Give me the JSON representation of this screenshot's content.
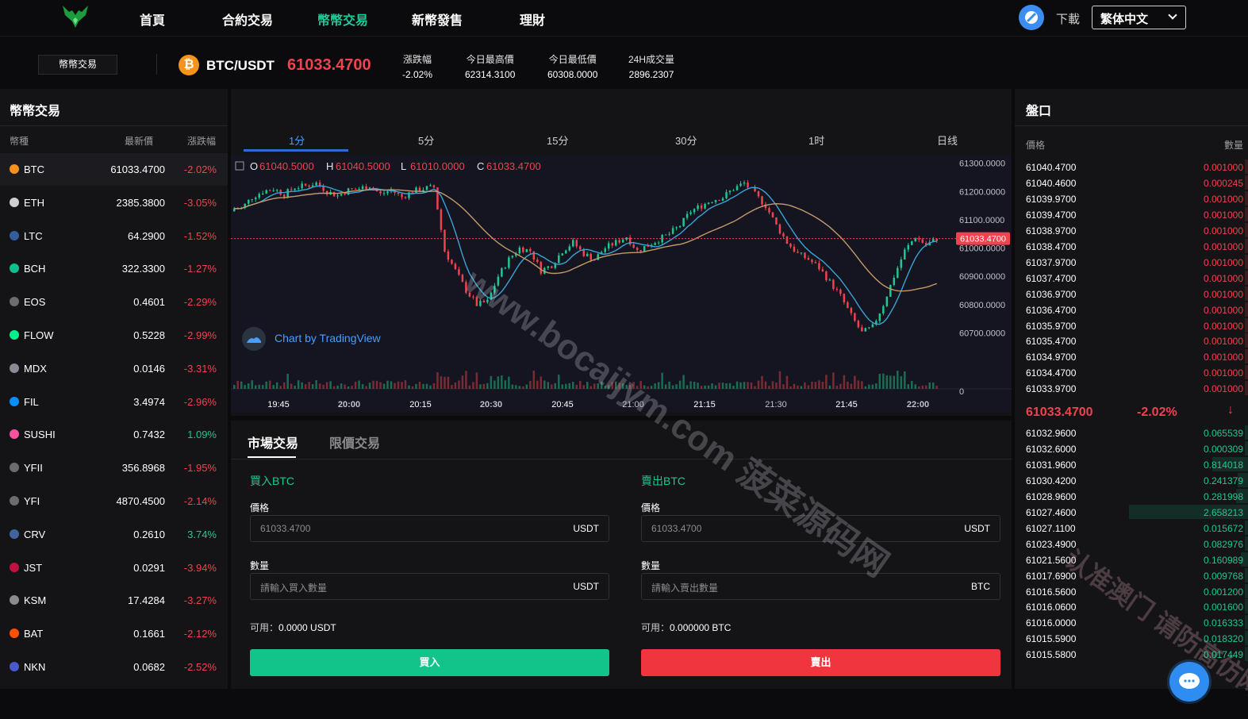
{
  "nav": {
    "items": [
      {
        "label": "首頁",
        "active": false
      },
      {
        "label": "合約交易",
        "active": false
      },
      {
        "label": "幣幣交易",
        "active": true
      },
      {
        "label": "新幣發售",
        "active": false
      },
      {
        "label": "理財",
        "active": false
      }
    ],
    "download_label": "下載",
    "language": "繁体中文"
  },
  "ticker": {
    "tab_label": "幣幣交易",
    "pair": "BTC/USDT",
    "last_price": "61033.4700",
    "stats": [
      {
        "label": "漲跌幅",
        "value": "-2.02%"
      },
      {
        "label": "今日最高價",
        "value": "62314.3100"
      },
      {
        "label": "今日最低價",
        "value": "60308.0000"
      },
      {
        "label": "24H成交量",
        "value": "2896.2307"
      }
    ]
  },
  "market": {
    "title": "幣幣交易",
    "headers": {
      "coin": "幣種",
      "price": "最新價",
      "change": "漲跌幅"
    },
    "rows": [
      {
        "coin": "BTC",
        "price": "61033.4700",
        "change": "-2.02%",
        "color": "#f7931a"
      },
      {
        "coin": "ETH",
        "price": "2385.3800",
        "change": "-3.05%",
        "color": "#cfcfcf"
      },
      {
        "coin": "LTC",
        "price": "64.2900",
        "change": "-1.52%",
        "color": "#345d9d"
      },
      {
        "coin": "BCH",
        "price": "322.3300",
        "change": "-1.27%",
        "color": "#0ac18e"
      },
      {
        "coin": "EOS",
        "price": "0.4601",
        "change": "-2.29%",
        "color": "#6b6b70"
      },
      {
        "coin": "FLOW",
        "price": "0.5228",
        "change": "-2.99%",
        "color": "#00ef8b"
      },
      {
        "coin": "MDX",
        "price": "0.0146",
        "change": "-3.31%",
        "color": "#8a8a95"
      },
      {
        "coin": "FIL",
        "price": "3.4974",
        "change": "-2.96%",
        "color": "#0090ff"
      },
      {
        "coin": "SUSHI",
        "price": "0.7432",
        "change": "1.09%",
        "color": "#fa52a0"
      },
      {
        "coin": "YFII",
        "price": "356.8968",
        "change": "-1.95%",
        "color": "#6b6b70"
      },
      {
        "coin": "YFI",
        "price": "4870.4500",
        "change": "-2.14%",
        "color": "#6b6b70"
      },
      {
        "coin": "CRV",
        "price": "0.2610",
        "change": "3.74%",
        "color": "#40649f"
      },
      {
        "coin": "JST",
        "price": "0.0291",
        "change": "-3.94%",
        "color": "#c2103f"
      },
      {
        "coin": "KSM",
        "price": "17.4284",
        "change": "-3.27%",
        "color": "#8a8a90"
      },
      {
        "coin": "BAT",
        "price": "0.1661",
        "change": "-2.12%",
        "color": "#ff5000"
      },
      {
        "coin": "NKN",
        "price": "0.0682",
        "change": "-2.52%",
        "color": "#4a5ac8"
      }
    ]
  },
  "chart": {
    "intervals": [
      "1分",
      "5分",
      "15分",
      "30分",
      "1时",
      "日线"
    ],
    "active_interval": "1分",
    "ohlc": {
      "o_label": "O",
      "o": "61040.5000",
      "h_label": "H",
      "h": "61040.5000",
      "l_label": "L",
      "l": "61010.0000",
      "c_label": "C",
      "c": "61033.4700"
    },
    "current_price_tag": "61033.4700",
    "attribution": "Chart by TradingView",
    "watermark": "www.bocaijym.com 菠菜源码网"
  },
  "chart_data": {
    "type": "candlestick",
    "y_ticks": [
      "61300.0000",
      "61200.0000",
      "61100.0000",
      "61000.0000",
      "60900.0000",
      "60800.0000",
      "60700.0000"
    ],
    "x_ticks": [
      "19:45",
      "20:00",
      "20:15",
      "20:30",
      "20:45",
      "21:00",
      "21:15",
      "21:30",
      "21:45",
      "22:00"
    ],
    "volume_zero_label": "0",
    "ylim": [
      60600,
      61330
    ],
    "close_path": [
      61140,
      61180,
      61200,
      61210,
      61190,
      61215,
      61220,
      61230,
      61200,
      61185,
      61205,
      61210,
      61220,
      61190,
      61205,
      61180,
      61200,
      61210,
      61215,
      60990,
      60920,
      60850,
      60800,
      60810,
      60900,
      60960,
      61000,
      60990,
      60920,
      60940,
      60990,
      61020,
      60980,
      60960,
      61000,
      61020,
      61040,
      60990,
      61010,
      61030,
      61050,
      61080,
      61130,
      61150,
      61170,
      61180,
      61210,
      61230,
      61190,
      61150,
      61080,
      61020,
      60980,
      60960,
      60930,
      60880,
      60830,
      60760,
      60700,
      60720,
      60800,
      60900,
      60990,
      61040,
      61010,
      61033
    ]
  },
  "trade": {
    "tabs": [
      "市場交易",
      "限價交易"
    ],
    "buy": {
      "title": "買入BTC",
      "price_label": "價格",
      "price_placeholder": "61033.4700",
      "price_unit": "USDT",
      "qty_label": "數量",
      "qty_placeholder": "請輸入買入數量",
      "qty_unit": "USDT",
      "avail_label": "可用：",
      "avail_value": "0.0000 USDT",
      "button": "買入"
    },
    "sell": {
      "title": "賣出BTC",
      "price_label": "價格",
      "price_placeholder": "61033.4700",
      "price_unit": "USDT",
      "qty_label": "數量",
      "qty_placeholder": "請輸入賣出數量",
      "qty_unit": "BTC",
      "avail_label": "可用：",
      "avail_value": "0.000000 BTC",
      "button": "賣出"
    }
  },
  "orderbook": {
    "title": "盤口",
    "headers": {
      "price": "價格",
      "qty": "數量"
    },
    "asks": [
      {
        "price": "61040.4700",
        "qty": "0.001000",
        "depth": 0.02
      },
      {
        "price": "61040.4600",
        "qty": "0.000245",
        "depth": 0.005
      },
      {
        "price": "61039.9700",
        "qty": "0.001000",
        "depth": 0.02
      },
      {
        "price": "61039.4700",
        "qty": "0.001000",
        "depth": 0.02
      },
      {
        "price": "61038.9700",
        "qty": "0.001000",
        "depth": 0.02
      },
      {
        "price": "61038.4700",
        "qty": "0.001000",
        "depth": 0.02
      },
      {
        "price": "61037.9700",
        "qty": "0.001000",
        "depth": 0.02
      },
      {
        "price": "61037.4700",
        "qty": "0.001000",
        "depth": 0.02
      },
      {
        "price": "61036.9700",
        "qty": "0.001000",
        "depth": 0.02
      },
      {
        "price": "61036.4700",
        "qty": "0.001000",
        "depth": 0.02
      },
      {
        "price": "61035.9700",
        "qty": "0.001000",
        "depth": 0.02
      },
      {
        "price": "61035.4700",
        "qty": "0.001000",
        "depth": 0.02
      },
      {
        "price": "61034.9700",
        "qty": "0.001000",
        "depth": 0.02
      },
      {
        "price": "61034.4700",
        "qty": "0.001000",
        "depth": 0.02
      },
      {
        "price": "61033.9700",
        "qty": "0.001000",
        "depth": 0.02
      }
    ],
    "mid_price": "61033.4700",
    "mid_change": "-2.02%",
    "mid_arrow": "↓",
    "bids": [
      {
        "price": "61032.9600",
        "qty": "0.065539",
        "depth": 0.03
      },
      {
        "price": "61032.6000",
        "qty": "0.000309",
        "depth": 0.005
      },
      {
        "price": "61031.9600",
        "qty": "0.814018",
        "depth": 0.3
      },
      {
        "price": "61030.4200",
        "qty": "0.241379",
        "depth": 0.09
      },
      {
        "price": "61028.9600",
        "qty": "0.281998",
        "depth": 0.1
      },
      {
        "price": "61027.4600",
        "qty": "2.658213",
        "depth": 1.0
      },
      {
        "price": "61027.1100",
        "qty": "0.015672",
        "depth": 0.01
      },
      {
        "price": "61023.4900",
        "qty": "0.082976",
        "depth": 0.03
      },
      {
        "price": "61021.5600",
        "qty": "0.160989",
        "depth": 0.06
      },
      {
        "price": "61017.6900",
        "qty": "0.009768",
        "depth": 0.005
      },
      {
        "price": "61016.5600",
        "qty": "0.001200",
        "depth": 0.005
      },
      {
        "price": "61016.0600",
        "qty": "0.001600",
        "depth": 0.005
      },
      {
        "price": "61016.0000",
        "qty": "0.016333",
        "depth": 0.01
      },
      {
        "price": "61015.5900",
        "qty": "0.018320",
        "depth": 0.01
      },
      {
        "price": "61015.5800",
        "qty": "0.017449",
        "depth": 0.01
      }
    ],
    "watermark": "认准澳门 请防高仿网站"
  },
  "colors": {
    "up": "#1fc691",
    "down": "#f0424f",
    "accent": "#20c99a",
    "link": "#4a9eff"
  }
}
